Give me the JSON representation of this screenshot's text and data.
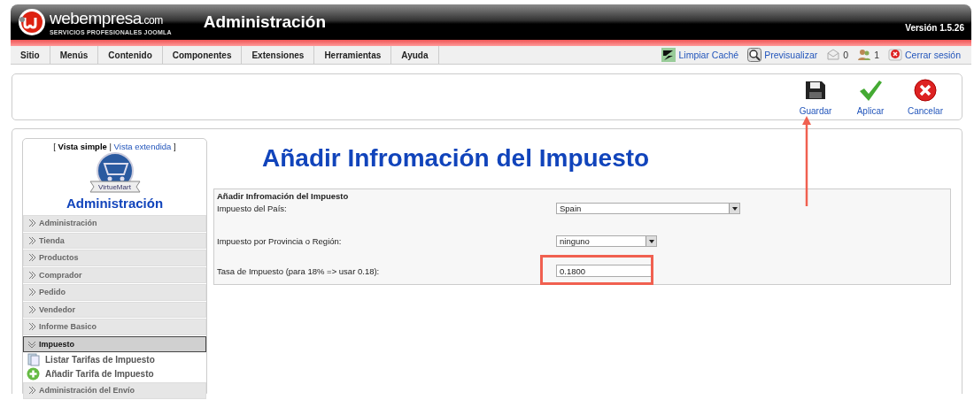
{
  "header": {
    "brand": "webempresa",
    "brand_suffix": ".com",
    "tagline": "SERVICIOS PROFESIONALES JOOMLA",
    "title": "Administración",
    "version": "Versión 1.5.26"
  },
  "menu": [
    "Sitio",
    "Menús",
    "Contenido",
    "Componentes",
    "Extensiones",
    "Herramientas",
    "Ayuda"
  ],
  "status_items": [
    {
      "kind": "cache",
      "label": "Limpiar Caché"
    },
    {
      "kind": "preview",
      "label": "Previsualizar"
    },
    {
      "kind": "messages",
      "label": "0"
    },
    {
      "kind": "users",
      "label": "1"
    },
    {
      "kind": "logout",
      "label": "Cerrar sesión"
    }
  ],
  "toolbar": [
    {
      "kind": "save",
      "label": "Guardar"
    },
    {
      "kind": "apply",
      "label": "Aplicar"
    },
    {
      "kind": "cancel",
      "label": "Cancelar"
    }
  ],
  "sidebar": {
    "bracket_open": "[",
    "view_simple": "Vista simple",
    "separator": "|",
    "bracket_close": "]",
    "view_extended": "Vista extendida",
    "logo_text": "VirtueMart",
    "title": "Administración",
    "items": [
      {
        "label": "Administración",
        "expanded": false
      },
      {
        "label": "Tienda",
        "expanded": false
      },
      {
        "label": "Productos",
        "expanded": false
      },
      {
        "label": "Comprador",
        "expanded": false
      },
      {
        "label": "Pedido",
        "expanded": false
      },
      {
        "label": "Vendedor",
        "expanded": false
      },
      {
        "label": "Informe Basico",
        "expanded": false
      },
      {
        "label": "Impuesto",
        "expanded": true,
        "children": [
          {
            "kind": "list",
            "label": "Listar Tarifas de Impuesto"
          },
          {
            "kind": "add",
            "label": "Añadir Tarifa de Impuesto"
          }
        ]
      },
      {
        "label": "Administración del Envío",
        "expanded": false
      }
    ]
  },
  "page_title": "Añadir Infromación del Impuesto",
  "form": {
    "legend": "Añadir Infromación del Impuesto",
    "fields": [
      {
        "kind": "select",
        "label": "Impuesto del País:",
        "value": "Spain"
      },
      {
        "kind": "select",
        "label": "Impuesto por Provincia o Región:",
        "value": "ninguno"
      },
      {
        "kind": "text",
        "label": "Tasa de Impuesto (para 18% => usar 0.18):",
        "value": "0.1800",
        "highlighted": true
      }
    ]
  },
  "callouts": [
    {
      "kind": "arrow"
    }
  ]
}
